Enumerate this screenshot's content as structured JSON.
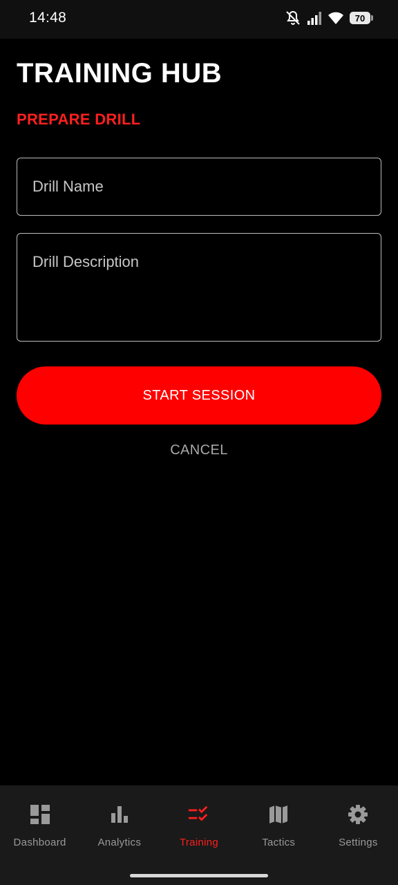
{
  "status_bar": {
    "time": "14:48",
    "battery": "70",
    "icons": [
      "bell-muted-icon",
      "signal-icon",
      "wifi-icon",
      "battery-icon"
    ]
  },
  "header": {
    "title": "TRAINING HUB",
    "section": "PREPARE DRILL"
  },
  "form": {
    "drill_name_placeholder": "Drill Name",
    "drill_name_value": "",
    "drill_description_placeholder": "Drill Description",
    "drill_description_value": ""
  },
  "actions": {
    "start_label": "START SESSION",
    "cancel_label": "CANCEL"
  },
  "bottom_nav": {
    "items": [
      {
        "label": "Dashboard",
        "icon": "dashboard-icon",
        "active": false
      },
      {
        "label": "Analytics",
        "icon": "bar-chart-icon",
        "active": false
      },
      {
        "label": "Training",
        "icon": "checklist-icon",
        "active": true
      },
      {
        "label": "Tactics",
        "icon": "map-icon",
        "active": false
      },
      {
        "label": "Settings",
        "icon": "gear-icon",
        "active": false
      }
    ]
  },
  "colors": {
    "accent": "#ff0000",
    "background": "#000000",
    "nav_background": "#1a1a1a",
    "inactive": "#9a9a9a"
  }
}
